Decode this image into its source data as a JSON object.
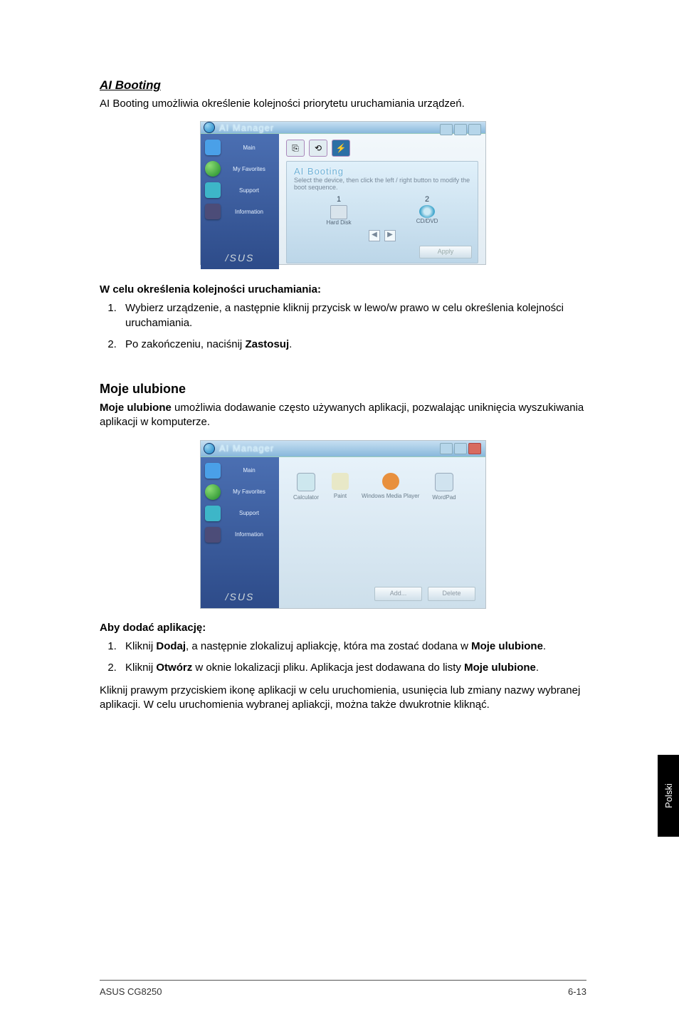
{
  "section1": {
    "title": "AI Booting",
    "intro": "AI Booting umożliwia określenie kolejności priorytetu uruchamiania urządzeń.",
    "window_title": "AI Manager",
    "sidebar": [
      "Main",
      "My Favorites",
      "Support",
      "Information"
    ],
    "brand": "/SUS",
    "panel_title": "AI Booting",
    "panel_desc": "Select the device, then click the left / right button to modify the boot sequence.",
    "dev1_num": "1",
    "dev1_label": "Hard Disk",
    "dev2_num": "2",
    "dev2_label": "CD/DVD",
    "pager_l": "◀",
    "pager_r": "▶",
    "apply_btn": "Apply",
    "sub_heading": "W celu określenia kolejności uruchamiania:",
    "step1_a": "Wybierz urządzenie, a następnie kliknij przycisk w lewo/w prawo w celu określenia kolejności uruchamiania.",
    "step2_a": "Po zakończeniu, naciśnij ",
    "step2_b": "Zastosuj",
    "step2_c": "."
  },
  "section2": {
    "title": "Moje ulubione",
    "intro_a": "Moje ulubione",
    "intro_b": " umożliwia dodawanie często używanych aplikacji, pozwalając uniknięcia wyszukiwania aplikacji w komputerze.",
    "window_title": "AI Manager",
    "sidebar": [
      "Main",
      "My Favorites",
      "Support",
      "Information"
    ],
    "brand": "/SUS",
    "apps": [
      "Calculator",
      "Paint",
      "Windows Media Player",
      "WordPad"
    ],
    "btn_add": "Add...",
    "btn_del": "Delete",
    "sub_heading": "Aby dodać aplikację:",
    "step1_a": "Kliknij ",
    "step1_b": "Dodaj",
    "step1_c": ", a następnie zlokalizuj apliakcję, która ma zostać dodana w ",
    "step1_d": "Moje ulubione",
    "step1_e": ".",
    "step2_a": "Kliknij ",
    "step2_b": "Otwórz",
    "step2_c": " w oknie lokalizacji pliku. Aplikacja jest dodawana do listy ",
    "step2_d": "Moje ulubione",
    "step2_e": ".",
    "outro": "Kliknij prawym przyciskiem ikonę aplikacji w celu uruchomienia, usunięcia lub zmiany nazwy wybranej aplikacji. W celu uruchomienia wybranej apliakcji, można także dwukrotnie kliknąć."
  },
  "sidetab": "Polski",
  "footer_left": "ASUS CG8250",
  "footer_right": "6-13"
}
